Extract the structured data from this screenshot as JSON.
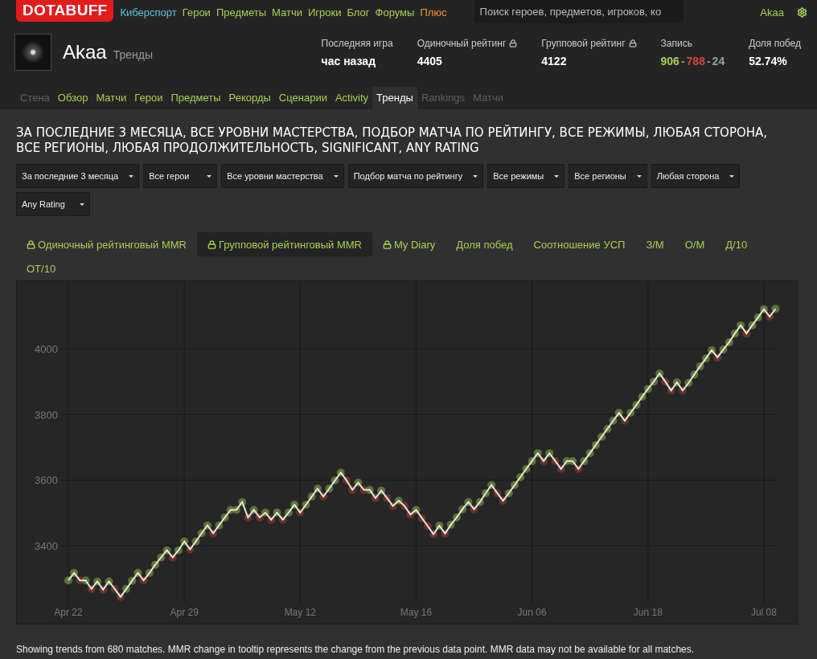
{
  "top_bar": {
    "logo": "DOTABUFF",
    "links": [
      {
        "label": "Киберспорт",
        "color": "#5fc4d8"
      },
      {
        "label": "Герои",
        "color": "#a9cf54"
      },
      {
        "label": "Предметы",
        "color": "#a9cf54"
      },
      {
        "label": "Матчи",
        "color": "#a9cf54"
      },
      {
        "label": "Игроки",
        "color": "#a9cf54"
      },
      {
        "label": "Блог",
        "color": "#a9cf54"
      },
      {
        "label": "Форумы",
        "color": "#a9cf54"
      },
      {
        "label": "Плюс",
        "color": "#f0932b"
      }
    ],
    "search": {
      "placeholder": "Поиск героев, предметов, игроков, ко"
    },
    "user": "Akaa"
  },
  "profile": {
    "name": "Akaa",
    "section": "Тренды",
    "stats": [
      {
        "kind": "text",
        "label": "Последняя игра",
        "locked": false,
        "value": "час назад"
      },
      {
        "kind": "text",
        "label": "Одиночный рейтинг",
        "locked": true,
        "value": "4405"
      },
      {
        "kind": "text",
        "label": "Групповой рейтинг",
        "locked": true,
        "value": "4122"
      },
      {
        "kind": "record",
        "label": "Запись",
        "locked": false,
        "wins": "906",
        "losses": "788",
        "abandons": "24",
        "separator": "-"
      },
      {
        "kind": "text",
        "label": "Доля побед",
        "locked": false,
        "value": "52.74%"
      }
    ]
  },
  "nav_tabs": [
    {
      "label": "Стена",
      "selected": false,
      "disabled": true
    },
    {
      "label": "Обзор",
      "selected": false,
      "disabled": false
    },
    {
      "label": "Матчи",
      "selected": false,
      "disabled": false
    },
    {
      "label": "Герои",
      "selected": false,
      "disabled": false
    },
    {
      "label": "Предметы",
      "selected": false,
      "disabled": false
    },
    {
      "label": "Рекорды",
      "selected": false,
      "disabled": false
    },
    {
      "label": "Сценарии",
      "selected": false,
      "disabled": false
    },
    {
      "label": "Activity",
      "selected": false,
      "disabled": false
    },
    {
      "label": "Тренды",
      "selected": true,
      "disabled": false
    },
    {
      "label": "Rankings",
      "selected": false,
      "disabled": true
    },
    {
      "label": "Матчи",
      "selected": false,
      "disabled": true
    }
  ],
  "heading": "ЗА ПОСЛЕДНИЕ 3 МЕСЯЦА, ВСЕ УРОВНИ МАСТЕРСТВА, ПОДБОР МАТЧА ПО РЕЙТИНГУ, ВСЕ РЕЖИМЫ, ЛЮБАЯ СТОРОНА, ВСЕ РЕГИОНЫ, ЛЮБАЯ ПРОДОЛЖИТЕЛЬНОСТЬ, SIGNIFICANT, ANY RATING",
  "filters": [
    "За последние 3 месяца",
    "Все герои",
    "Все уровни мастерства",
    "Подбор матча по рейтингу",
    "Все режимы",
    "Все регионы",
    "Любая сторона",
    "Any Rating"
  ],
  "metric_tabs": [
    {
      "label": "Одиночный рейтинговый MMR",
      "locked": true,
      "selected": false
    },
    {
      "label": "Групповой рейтинговый MMR",
      "locked": true,
      "selected": true
    },
    {
      "label": "My Diary",
      "locked": true,
      "selected": false
    },
    {
      "label": "Доля побед",
      "locked": false,
      "selected": false
    },
    {
      "label": "Соотношение УСП",
      "locked": false,
      "selected": false
    },
    {
      "label": "З/М",
      "locked": false,
      "selected": false
    },
    {
      "label": "О/М",
      "locked": false,
      "selected": false
    },
    {
      "label": "Д/10",
      "locked": false,
      "selected": false
    },
    {
      "label": "ОТ/10",
      "locked": false,
      "selected": false
    }
  ],
  "chart": {
    "chart_data": {
      "type": "line",
      "grid": true,
      "yticks": [
        3400,
        3600,
        3800,
        4000
      ],
      "ylim": [
        3226,
        4206
      ],
      "categories": [
        "Apr 22",
        null,
        null,
        null,
        null,
        null,
        null,
        null,
        null,
        null,
        null,
        null,
        null,
        null,
        null,
        null,
        null,
        null,
        null,
        null,
        "Apr 29",
        null,
        null,
        null,
        null,
        null,
        null,
        null,
        null,
        null,
        null,
        null,
        null,
        null,
        null,
        null,
        null,
        null,
        null,
        null,
        "May 12",
        null,
        null,
        null,
        null,
        null,
        null,
        null,
        null,
        null,
        null,
        null,
        null,
        null,
        null,
        null,
        null,
        null,
        null,
        null,
        "May 16",
        null,
        null,
        null,
        null,
        null,
        null,
        null,
        null,
        null,
        null,
        null,
        null,
        null,
        null,
        null,
        null,
        null,
        null,
        null,
        "Jun 06",
        null,
        null,
        null,
        null,
        null,
        null,
        null,
        null,
        null,
        null,
        null,
        null,
        null,
        null,
        null,
        null,
        null,
        null,
        null,
        "Jun 18",
        null,
        null,
        null,
        null,
        null,
        null,
        null,
        null,
        null,
        null,
        null,
        null,
        null,
        null,
        null,
        null,
        null,
        null,
        null,
        "Jul 08",
        null,
        null
      ],
      "series": [
        {
          "color": "#e2ebcc",
          "marker": "circle",
          "values": [
            3294,
            3317,
            3294,
            3294,
            3268,
            3291,
            3266,
            3291,
            3268,
            3244,
            3268,
            3293,
            3317,
            3294,
            3317,
            3342,
            3364,
            3386,
            3364,
            3386,
            3413,
            3389,
            3413,
            3438,
            3462,
            3438,
            3462,
            3486,
            3509,
            3509,
            3533,
            3486,
            3509,
            3486,
            3501,
            3479,
            3501,
            3479,
            3501,
            3525,
            3501,
            3525,
            3550,
            3574,
            3550,
            3574,
            3599,
            3623,
            3599,
            3570,
            3592,
            3570,
            3570,
            3545,
            3568,
            3545,
            3521,
            3537,
            3521,
            3495,
            3509,
            3484,
            3460,
            3435,
            3461,
            3437,
            3464,
            3486,
            3511,
            3533,
            3511,
            3533,
            3560,
            3585,
            3560,
            3537,
            3560,
            3585,
            3609,
            3634,
            3658,
            3682,
            3658,
            3682,
            3658,
            3634,
            3658,
            3658,
            3634,
            3658,
            3682,
            3707,
            3732,
            3756,
            3781,
            3805,
            3781,
            3805,
            3829,
            3854,
            3878,
            3900,
            3925,
            3900,
            3873,
            3898,
            3873,
            3896,
            3922,
            3947,
            3971,
            3996,
            3974,
            3998,
            4020,
            4047,
            4072,
            4047,
            4072,
            4096,
            4121,
            4098,
            4122
          ]
        }
      ]
    }
  },
  "footnote": "Showing trends from 680 matches. MMR change in tooltip represents the change from the previous data point. MMR data may not be available for all matches."
}
